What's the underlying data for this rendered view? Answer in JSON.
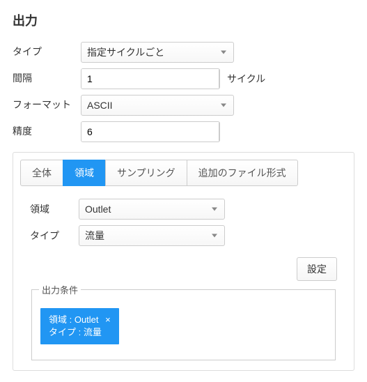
{
  "title": "出力",
  "fields": {
    "type_label": "タイプ",
    "type_value": "指定サイクルごと",
    "interval_label": "間隔",
    "interval_value": "1",
    "interval_unit": "サイクル",
    "format_label": "フォーマット",
    "format_value": "ASCII",
    "precision_label": "精度",
    "precision_value": "6"
  },
  "tabs": {
    "all": "全体",
    "region": "領域",
    "sampling": "サンプリング",
    "extra": "追加のファイル形式"
  },
  "region": {
    "region_label": "領域",
    "region_value": "Outlet",
    "type_label": "タイプ",
    "type_value": "流量",
    "set_button": "設定",
    "conditions_legend": "出力条件",
    "chip_line1": "領域 : Outlet",
    "chip_line2": "タイプ : 流量",
    "chip_close": "×"
  }
}
